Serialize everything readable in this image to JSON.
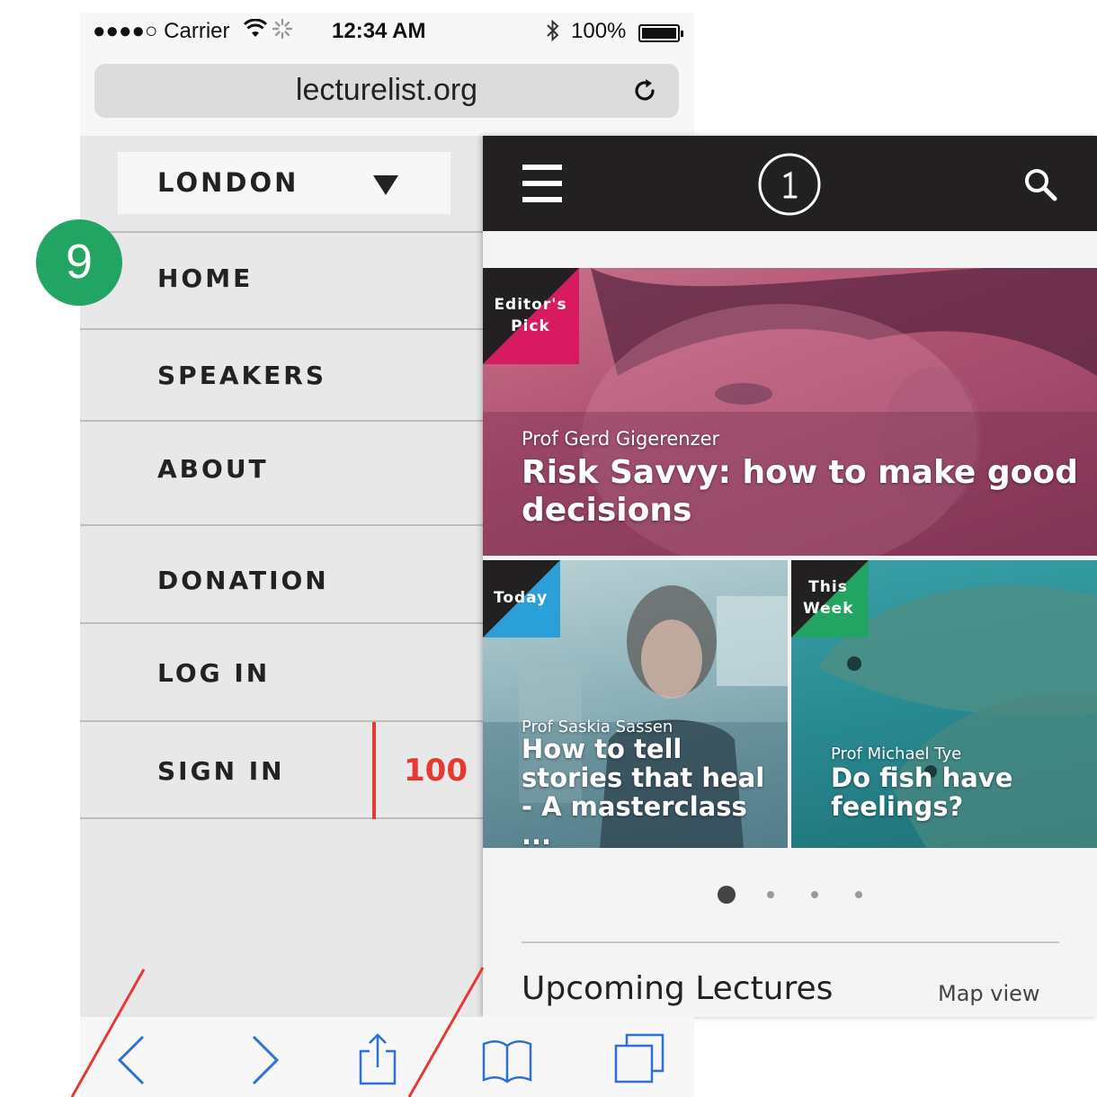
{
  "status_bar": {
    "signal": "●●●●○ Carrier",
    "time": "12:34 AM",
    "battery": "100%"
  },
  "browser": {
    "url": "lecturelist.org"
  },
  "nav": {
    "city": "LONDON",
    "step_badge": "9",
    "items": [
      {
        "label": "HOME"
      },
      {
        "label": "SPEAKERS"
      },
      {
        "label": "ABOUT"
      },
      {
        "label": "DONATION"
      },
      {
        "label": "LOG IN"
      },
      {
        "label": "SIGN IN"
      }
    ],
    "signin_count": "100"
  },
  "cards": {
    "featured": {
      "tag_line1": "Editor's",
      "tag_line2": "Pick",
      "speaker": "Prof Gerd Gigerenzer",
      "title": "Risk Savvy: how to make good decisions",
      "tag_color": "#d81b60"
    },
    "today": {
      "tag": "Today",
      "speaker": "Prof Saskia Sassen",
      "title": "How to tell stories that heal - A masterclass ...",
      "tag_color": "#2a9fd8"
    },
    "week": {
      "tag_line1": "This",
      "tag_line2": "Week",
      "speaker": "Prof Michael Tye",
      "title": "Do fish have feelings?",
      "tag_color": "#22a463"
    }
  },
  "pager": {
    "total": 4,
    "active": 0
  },
  "upcoming": {
    "title": "Upcoming Lectures",
    "map_view": "Map view"
  },
  "colors": {
    "topbar": "#222020",
    "accent_red": "#e53935",
    "badge_green": "#22a463"
  },
  "icons": [
    "wifi-icon",
    "bluetooth-icon",
    "battery-icon",
    "reload-icon",
    "menu-icon",
    "logo-icon",
    "search-icon",
    "back-icon",
    "forward-icon",
    "share-icon",
    "bookmarks-icon",
    "tabs-icon"
  ]
}
